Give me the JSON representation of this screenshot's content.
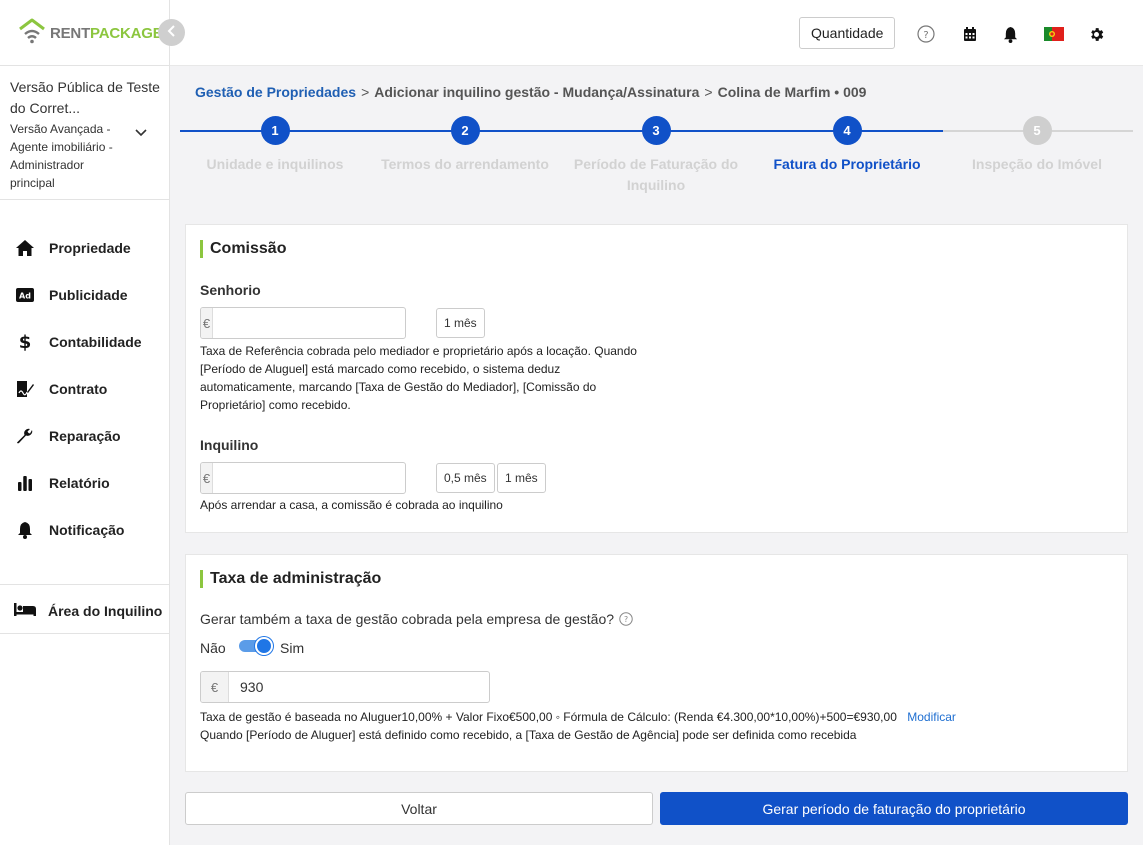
{
  "brand": {
    "rent": "RENT",
    "package": "PACKAGE"
  },
  "account": {
    "name": "Versão Pública de Teste do Corret...",
    "role": "Versão Avançada - Agente imobiliário - Administrador principal"
  },
  "nav": {
    "items": [
      {
        "label": "Propriedade",
        "icon": "home-icon"
      },
      {
        "label": "Publicidade",
        "icon": "ad-icon"
      },
      {
        "label": "Contabilidade",
        "icon": "dollar-icon"
      },
      {
        "label": "Contrato",
        "icon": "contract-icon"
      },
      {
        "label": "Reparação",
        "icon": "wrench-icon"
      },
      {
        "label": "Relatório",
        "icon": "bar-chart-icon"
      },
      {
        "label": "Notificação",
        "icon": "bell-icon"
      }
    ],
    "tenant_area": "Área do Inquilino"
  },
  "topbar": {
    "quantity_label": "Quantidade",
    "icons": [
      "help-icon",
      "calendar-icon",
      "bell-icon",
      "portugal-flag-icon",
      "gear-icon"
    ]
  },
  "breadcrumb": {
    "root": "Gestão de Propriedades",
    "sep": ">",
    "step": "Adicionar inquilino gestão - Mudança/Assinatura",
    "current": "Colina de Marfim • 009"
  },
  "steps": {
    "active_index": 4,
    "items": [
      {
        "number": "1",
        "label": "Unidade e inquilinos"
      },
      {
        "number": "2",
        "label": "Termos do arrendamento"
      },
      {
        "number": "3",
        "label": "Período de Faturação do Inquilino"
      },
      {
        "number": "4",
        "label": "Fatura do Proprietário"
      },
      {
        "number": "5",
        "label": "Inspeção do Imóvel"
      }
    ]
  },
  "commission": {
    "title": "Comissão",
    "landlord": {
      "label": "Senhorio",
      "currency": "€",
      "value": "",
      "chips": [
        "1 mês"
      ],
      "help": "Taxa de Referência cobrada pelo mediador e proprietário após a locação. Quando [Período de Aluguel] está marcado como recebido, o sistema deduz automaticamente, marcando [Taxa de Gestão do Mediador], [Comissão do Proprietário] como recebido."
    },
    "tenant": {
      "label": "Inquilino",
      "currency": "€",
      "value": "",
      "chips": [
        "0,5 mês",
        "1 mês"
      ],
      "help": "Após arrendar a casa, a comissão é cobrada ao inquilino"
    }
  },
  "admin_fee": {
    "title": "Taxa de administração",
    "question": "Gerar também a taxa de gestão cobrada pela empresa de gestão?",
    "toggle_off": "Não",
    "toggle_on": "Sim",
    "toggle_state": "on",
    "currency": "€",
    "value": "930",
    "formula": "Taxa de gestão é baseada no Aluguer10,00% + Valor Fixo€500,00 ◦ Fórmula de Cálculo: (Renda €4.300,00*10,00%)+500=€930,00",
    "modify_link": "Modificar",
    "note": "Quando [Período de Aluguer] está definido como recebido, a [Taxa de Gestão de Agência] pode ser definida como recebida"
  },
  "actions": {
    "back": "Voltar",
    "generate": "Gerar período de faturação do proprietário"
  },
  "colors": {
    "accent_blue": "#1051c8",
    "brand_green": "#8cc63f",
    "step_inactive": "#cfcfcf"
  }
}
